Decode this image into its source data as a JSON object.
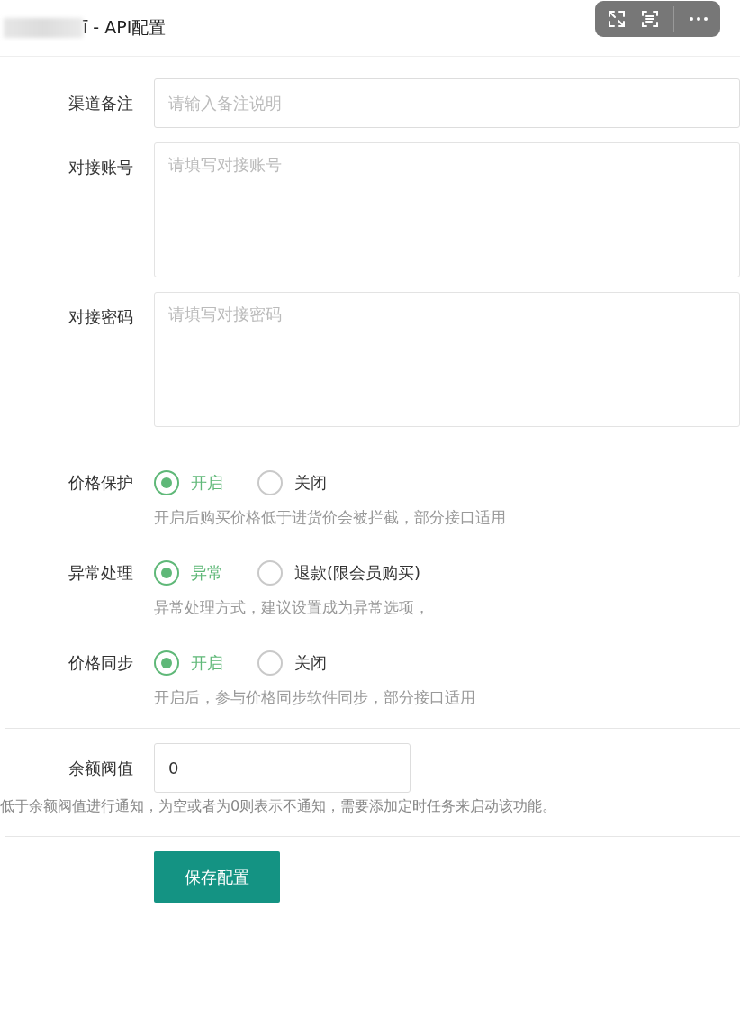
{
  "header": {
    "title": "ī - API配置"
  },
  "fields": [
    {
      "kind": "input",
      "label": "渠道备注",
      "placeholder": "请输入备注说明"
    },
    {
      "kind": "textarea",
      "label": "对接账号",
      "placeholder": "请填写对接账号"
    },
    {
      "kind": "textarea",
      "label": "对接密码",
      "placeholder": "请填写对接密码"
    }
  ],
  "radio_groups": [
    {
      "label": "价格保护",
      "options": [
        {
          "label": "开启",
          "selected": true
        },
        {
          "label": "关闭",
          "selected": false
        }
      ],
      "help": "开启后购买价格低于进货价会被拦截，部分接口适用"
    },
    {
      "label": "异常处理",
      "options": [
        {
          "label": "异常",
          "selected": true
        },
        {
          "label": "退款(限会员购买)",
          "selected": false
        }
      ],
      "help": "异常处理方式，建议设置成为异常选项，"
    },
    {
      "label": "价格同步",
      "options": [
        {
          "label": "开启",
          "selected": true
        },
        {
          "label": "关闭",
          "selected": false
        }
      ],
      "help": "开启后，参与价格同步软件同步，部分接口适用"
    }
  ],
  "balance": {
    "label": "余额阀值",
    "value": "0",
    "note": "低于余额阀值进行通知，为空或者为0则表示不通知，需要添加定时任务来启动该功能。"
  },
  "save_button": "保存配置"
}
